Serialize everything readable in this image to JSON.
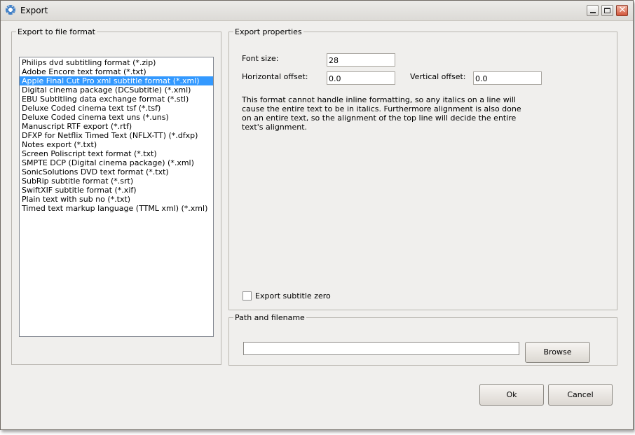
{
  "window": {
    "title": "Export"
  },
  "format_group": {
    "legend": "Export to file format",
    "items": [
      "Philips dvd subtitling format (*.zip)",
      "Adobe Encore text format (*.txt)",
      "Apple Final Cut Pro xml subtitle format (*.xml)",
      "Digital cinema package (DCSubtitle) (*.xml)",
      "EBU Subtitling data exchange format (*.stl)",
      "Deluxe Coded cinema text tsf (*.tsf)",
      "Deluxe Coded cinema text uns (*.uns)",
      "Manuscript RTF export (*.rtf)",
      "DFXP for Netflix Timed Text (NFLX-TT) (*.dfxp)",
      "Notes export (*.txt)",
      "Screen Poliscript text format (*.txt)",
      "SMPTE DCP (Digital cinema package) (*.xml)",
      "SonicSolutions DVD text format (*.txt)",
      "SubRip subtitle format (*.srt)",
      "SwiftXIF subtitle format (*.xif)",
      "Plain text with sub no (*.txt)",
      "Timed text markup language (TTML xml) (*.xml)"
    ],
    "selected_index": 2
  },
  "props_group": {
    "legend": "Export properties",
    "font_size_label": "Font size:",
    "font_size_value": "28",
    "h_offset_label": "Horizontal offset:",
    "h_offset_value": "0.0",
    "v_offset_label": "Vertical offset:",
    "v_offset_value": "0.0",
    "description": "This format cannot handle inline formatting, so any italics on a line will cause the entire text to be in italics. Furthermore alignment is also done on an entire text, so the alignment of the top line will decide the entire text's alignment.",
    "export_zero_label": "Export subtitle zero",
    "export_zero_checked": false
  },
  "path_group": {
    "legend": "Path and filename",
    "path_value": "",
    "browse_label": "Browse"
  },
  "footer": {
    "ok_label": "Ok",
    "cancel_label": "Cancel"
  },
  "colors": {
    "selection": "#3399ff",
    "dialog_bg": "#f0efed"
  }
}
